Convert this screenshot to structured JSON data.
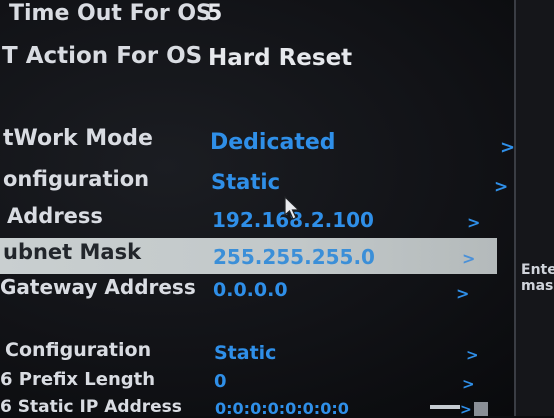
{
  "rows": [
    {
      "label": "Time Out For OS",
      "value": "5",
      "arrow": ">"
    },
    {
      "label": "T Action For OS",
      "value": "Hard Reset",
      "arrow": ">"
    },
    {
      "label": "tWork Mode",
      "value": "Dedicated",
      "arrow": ">"
    },
    {
      "label": "onfiguration",
      "value": "Static",
      "arrow": ">"
    },
    {
      "label": "Address",
      "value": "192.168.2.100",
      "arrow": ">"
    },
    {
      "label": "ubnet Mask",
      "value": "255.255.255.0",
      "arrow": ">"
    },
    {
      "label": "Gateway Address",
      "value": "0.0.0.0",
      "arrow": ">"
    },
    {
      "label": "Configuration",
      "value": "Static",
      "arrow": ">"
    },
    {
      "label": "6 Prefix Length",
      "value": "0",
      "arrow": ">"
    },
    {
      "label": "6 Static IP Address",
      "value": "0:0:0:0:0:0:0:0",
      "arrow": ">"
    }
  ],
  "help": {
    "line1": "Ente",
    "line2": "mas"
  },
  "icons": {
    "pointer": "mouse-pointer-icon"
  }
}
